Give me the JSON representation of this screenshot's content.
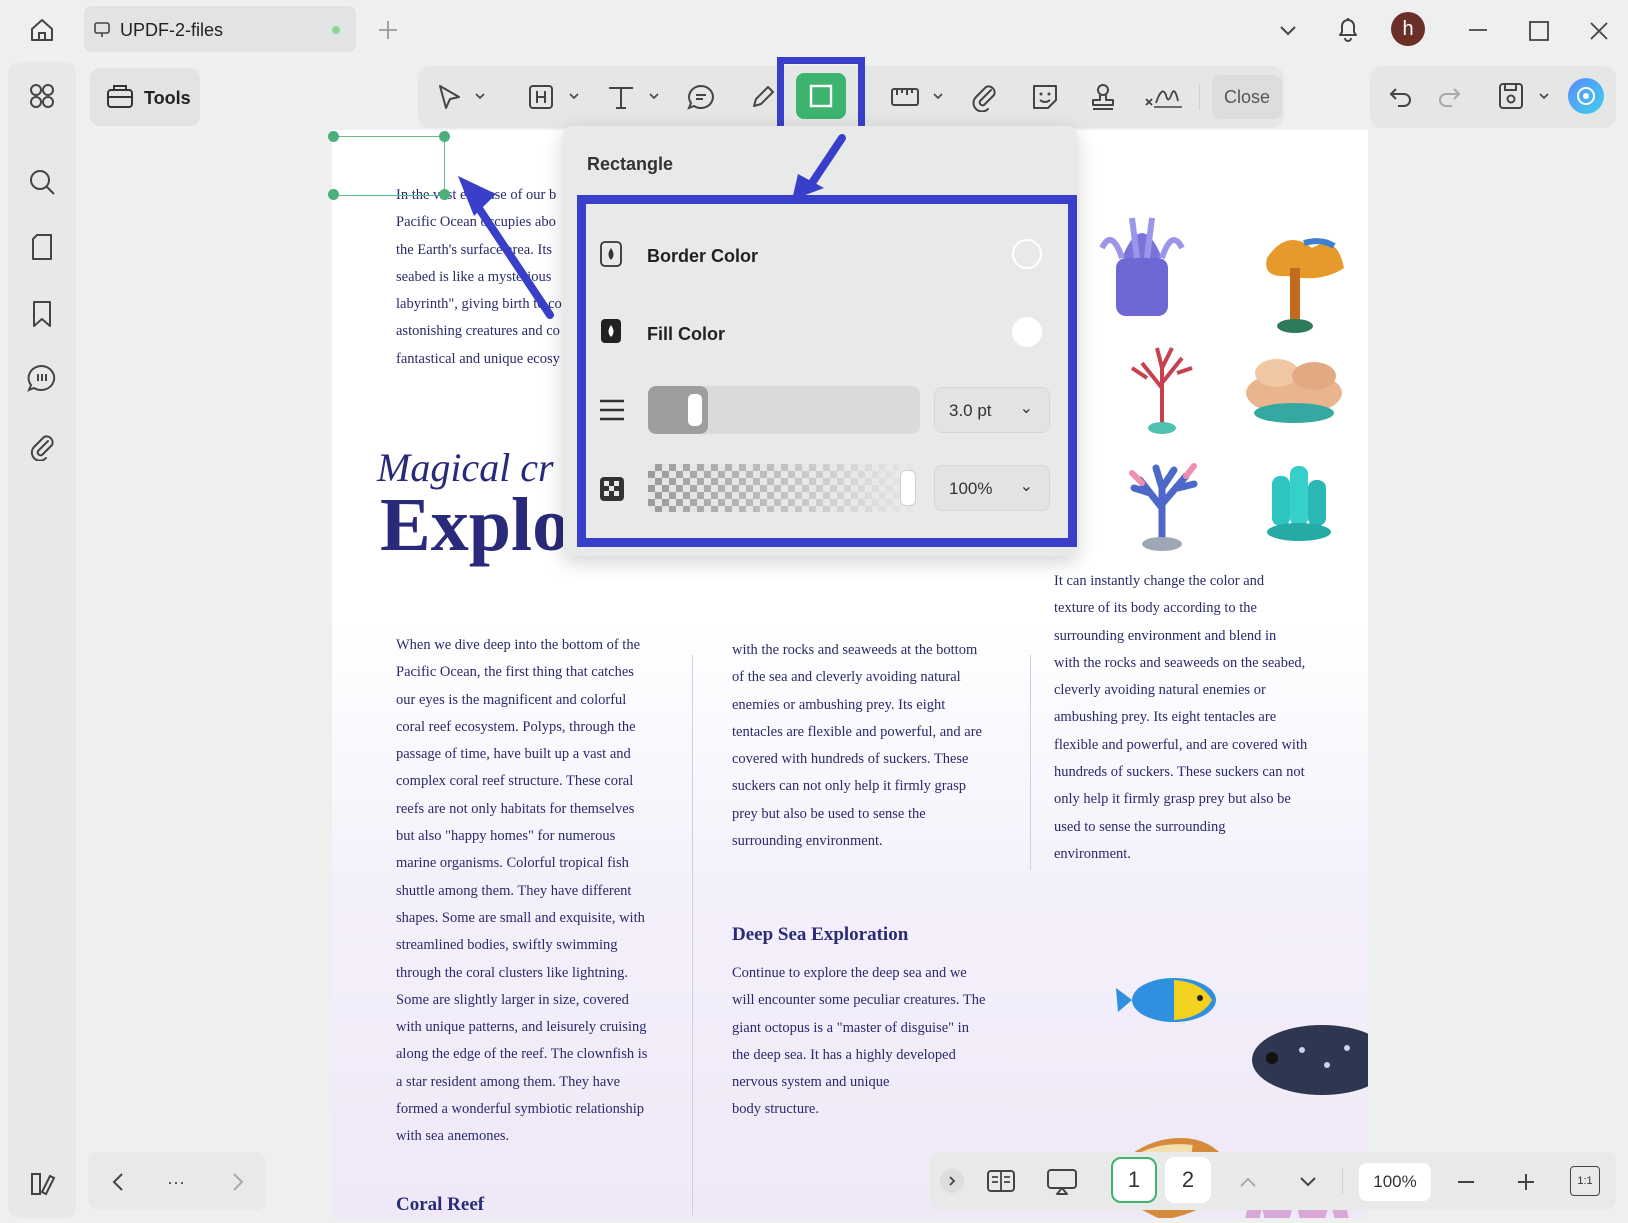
{
  "tab": {
    "title": "UPDF-2-files"
  },
  "user": {
    "avatar_letter": "h"
  },
  "toolbar": {
    "tools_label": "Tools",
    "close_label": "Close"
  },
  "popup": {
    "title": "Rectangle",
    "border_color_label": "Border Color",
    "fill_color_label": "Fill Color",
    "stroke_width": "3.0 pt",
    "opacity": "100%"
  },
  "document": {
    "intro": "In the vast expanse of our b\nPacific Ocean occupies abo\nthe Earth's surface area. Its\nseabed is like a mysterious\nlabyrinth\", giving birth to co\nastonishing creatures and co\nfantastical and unique ecosy",
    "subtitle": "Magical cr",
    "title": "Explore the Pacific",
    "col1": "When we dive deep into the bottom of the\nPacific Ocean, the first thing that catches\nour eyes is the magnificent and colorful\ncoral reef ecosystem. Polyps, through the\npassage of time, have built up a vast and\ncomplex coral reef structure. These coral\nreefs are not only habitats for themselves\nbut also \"happy homes\" for numerous\nmarine organisms. Colorful tropical fish\nshuttle among them. They have different\nshapes. Some are small and exquisite, with\nstreamlined bodies, swiftly swimming\nthrough the coral clusters like lightning.\nSome are slightly larger in size, covered\nwith unique patterns, and leisurely cruising\nalong the edge of the reef. The clownfish is\na star resident among them. They have\nformed a wonderful symbiotic relationship\nwith sea anemones.",
    "col1_heading": "Coral Reef",
    "col2": "with the rocks and seaweeds at the bottom\nof the sea and cleverly avoiding natural\nenemies or ambushing prey. Its eight\ntentacles are flexible and powerful, and are\ncovered with hundreds of suckers. These\nsuckers can not only help it firmly grasp\nprey but also be used to sense the\nsurrounding environment.",
    "col2_heading": "Deep Sea Exploration",
    "col2b": "Continue to explore the deep sea and we\nwill encounter some peculiar creatures. The\ngiant octopus is a \"master of disguise\" in\nthe deep sea. It has a highly developed\nnervous system and unique\nbody structure.",
    "col3": "It can instantly change the color and\ntexture of its body according to the\nsurrounding environment and blend in\nwith the rocks and seaweeds on the seabed,\ncleverly avoiding natural enemies or\nambushing prey. Its eight tentacles are\nflexible and powerful, and are covered with\nhundreds of suckers. These suckers can not\nonly help it firmly grasp prey but also be\nused to sense the surrounding\nenvironment."
  },
  "pagination": {
    "page1": "1",
    "page2": "2",
    "zoom": "100%",
    "more": "···",
    "fit": "1:1"
  },
  "colors": {
    "accent": "#3a3fc9",
    "selected_tool": "#3db36f",
    "doc_text": "#2a2a6a"
  }
}
